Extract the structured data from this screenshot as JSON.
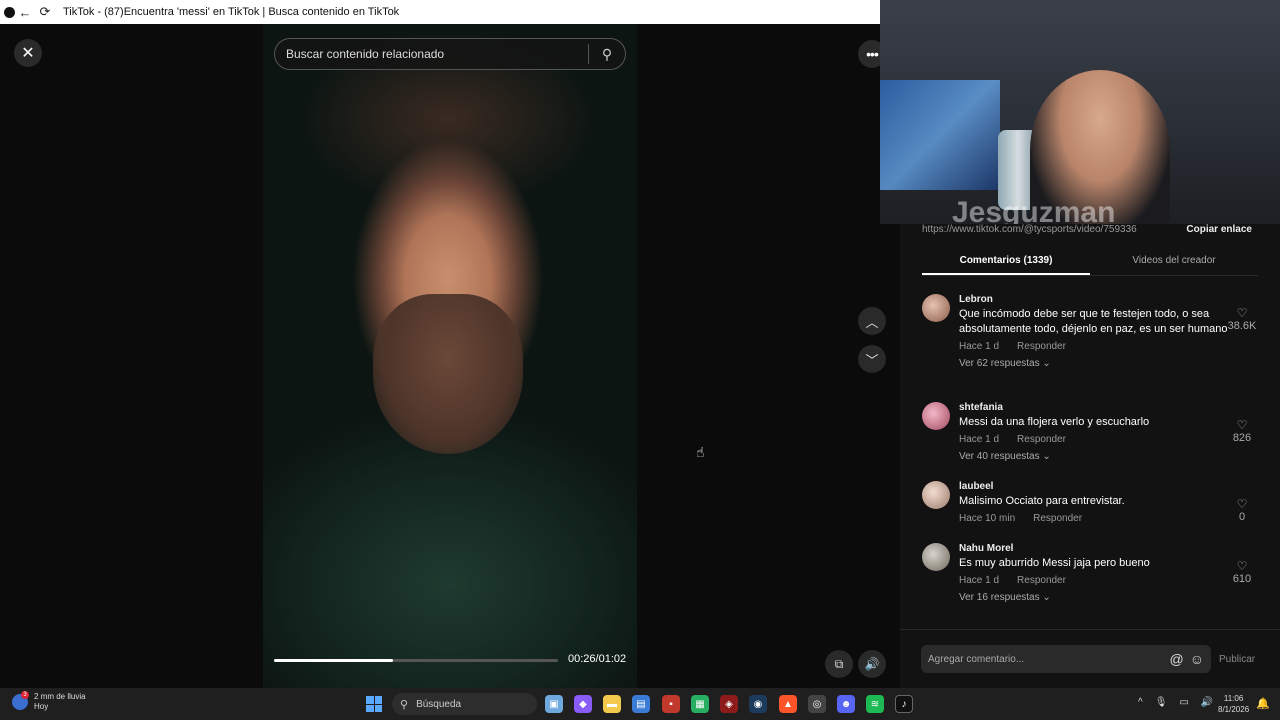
{
  "browser": {
    "title": "TikTok - (87)Encuentra 'messi' en TikTok | Busca contenido en TikTok",
    "back_icon": "←",
    "reload_icon": "⟳"
  },
  "player": {
    "close_icon": "✕",
    "search_placeholder": "Buscar contenido relacionado",
    "search_icon": "⚲",
    "more_icon": "•••",
    "up_icon": "︿",
    "down_icon": "﹀",
    "time": "00:26/01:02",
    "progress_fraction": 0.42,
    "pip_icon": "⧉",
    "volume_icon": "🔊"
  },
  "webcam": {
    "watermark": "Jesguzman_"
  },
  "panel": {
    "url": "https://www.tiktok.com/@tycsports/video/759336",
    "copy_link": "Copiar enlace",
    "tabs": [
      "Comentarios (1339)",
      "Videos del creador"
    ],
    "comments": [
      {
        "user": "Lebron",
        "text": "Que incómodo debe ser que te festejen todo, o sea absolutamente todo, déjenlo en paz, es un ser humano",
        "time": "Hace 1 d",
        "reply": "Responder",
        "replies": "Ver 62 respuestas ⌄",
        "likes": "38.6K"
      },
      {
        "user": "shtefania",
        "text": "Messi da una flojera verlo y escucharlo",
        "time": "Hace 1 d",
        "reply": "Responder",
        "replies": "Ver 40 respuestas ⌄",
        "likes": "826"
      },
      {
        "user": "laubeel",
        "text": "Malisimo Occiato para entrevistar.",
        "time": "Hace 10 min",
        "reply": "Responder",
        "replies": "",
        "likes": "0"
      },
      {
        "user": "Nahu Morel",
        "text": "Es muy aburrido Messi jaja pero bueno",
        "time": "Hace 1 d",
        "reply": "Responder",
        "replies": "Ver 16 respuestas ⌄",
        "likes": "610"
      }
    ],
    "compose_placeholder": "Agregar comentario...",
    "mention_icon": "@",
    "emoji_icon": "☺",
    "publish": "Publicar"
  },
  "taskbar": {
    "weather_text": "2 mm de lluvia",
    "weather_sub": "Hoy",
    "weather_badge": "3",
    "search_label": "Búsqueda",
    "time": "11:06",
    "date": "8/1/2026",
    "tray_icons": [
      "^",
      "🎙",
      "▭",
      "🔊"
    ],
    "bell_icon": "🔔"
  }
}
